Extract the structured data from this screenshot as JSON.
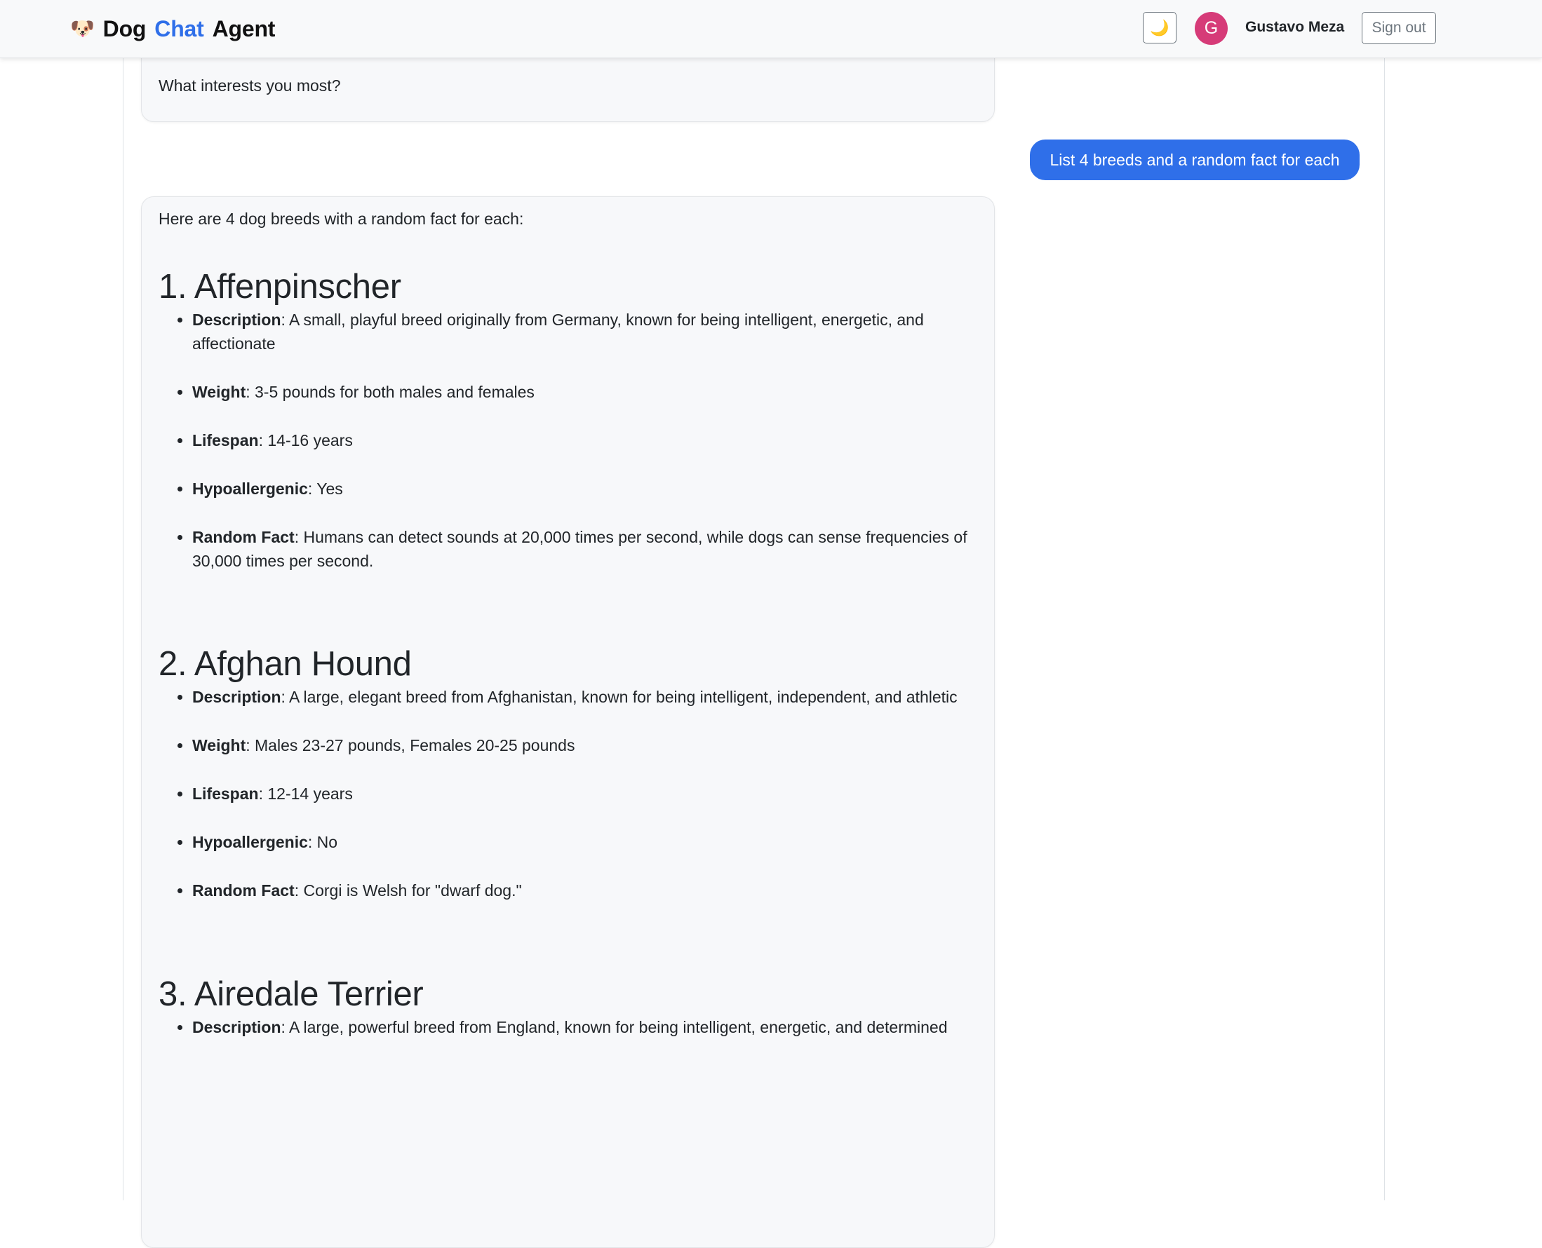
{
  "navbar": {
    "logo_icon": "dog-face-icon",
    "brand_part1": "Dog",
    "brand_part2": "Chat",
    "brand_part3": "Agent",
    "theme_toggle_icon": "🌙",
    "avatar_initial": "G",
    "user_name": "Gustavo Meza",
    "sign_out_label": "Sign out"
  },
  "colors": {
    "accent": "#2f6fe9",
    "avatar": "#d63b78",
    "bubble_bg": "#f7f8fa"
  },
  "chat": {
    "previous_bot_text": "What interests you most?",
    "user_message": "List 4 breeds and a random fact for each",
    "bot_intro": "Here are 4 dog breeds with a random fact for each:",
    "breeds": [
      {
        "title": "1. Affenpinscher",
        "facts": [
          {
            "key": "Description",
            "value": ": A small, playful breed originally from Germany, known for being intelligent, energetic, and affectionate"
          },
          {
            "key": "Weight",
            "value": ": 3-5 pounds for both males and females"
          },
          {
            "key": "Lifespan",
            "value": ": 14-16 years"
          },
          {
            "key": "Hypoallergenic",
            "value": ": Yes"
          },
          {
            "key": "Random Fact",
            "value": ": Humans can detect sounds at 20,000 times per second, while dogs can sense frequencies of 30,000 times per second."
          }
        ]
      },
      {
        "title": "2. Afghan Hound",
        "facts": [
          {
            "key": "Description",
            "value": ": A large, elegant breed from Afghanistan, known for being intelligent, independent, and athletic"
          },
          {
            "key": "Weight",
            "value": ": Males 23-27 pounds, Females 20-25 pounds"
          },
          {
            "key": "Lifespan",
            "value": ": 12-14 years"
          },
          {
            "key": "Hypoallergenic",
            "value": ": No"
          },
          {
            "key": "Random Fact",
            "value": ": Corgi is Welsh for \"dwarf dog.\""
          }
        ]
      },
      {
        "title": "3. Airedale Terrier",
        "facts": [
          {
            "key": "Description",
            "value": ": A large, powerful breed from England, known for being intelligent, energetic, and determined"
          }
        ]
      }
    ]
  }
}
